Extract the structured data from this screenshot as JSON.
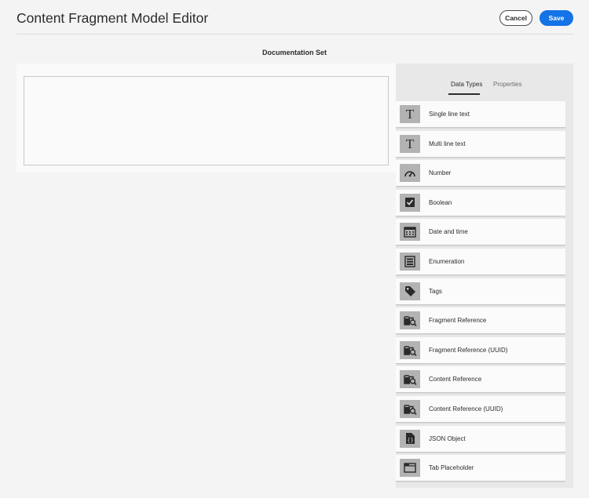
{
  "header": {
    "title": "Content Fragment Model Editor",
    "cancel_label": "Cancel",
    "save_label": "Save"
  },
  "model": {
    "name": "Documentation Set"
  },
  "panel": {
    "tabs": [
      {
        "label": "Data Types",
        "active": true
      },
      {
        "label": "Properties",
        "active": false
      }
    ],
    "data_types": [
      {
        "label": "Single line text",
        "icon": "text-icon"
      },
      {
        "label": "Multi line text",
        "icon": "text-icon"
      },
      {
        "label": "Number",
        "icon": "gauge-icon"
      },
      {
        "label": "Boolean",
        "icon": "checkbox-icon"
      },
      {
        "label": "Date and time",
        "icon": "calendar-icon"
      },
      {
        "label": "Enumeration",
        "icon": "list-icon"
      },
      {
        "label": "Tags",
        "icon": "tag-icon"
      },
      {
        "label": "Fragment Reference",
        "icon": "folder-search-icon"
      },
      {
        "label": "Fragment Reference (UUID)",
        "icon": "folder-search-icon"
      },
      {
        "label": "Content Reference",
        "icon": "folder-search-icon"
      },
      {
        "label": "Content Reference (UUID)",
        "icon": "folder-search-icon"
      },
      {
        "label": "JSON Object",
        "icon": "json-file-icon"
      },
      {
        "label": "Tab Placeholder",
        "icon": "tab-icon"
      }
    ]
  },
  "colors": {
    "accent": "#1473e6",
    "icon_bg": "#b3b3b3"
  }
}
